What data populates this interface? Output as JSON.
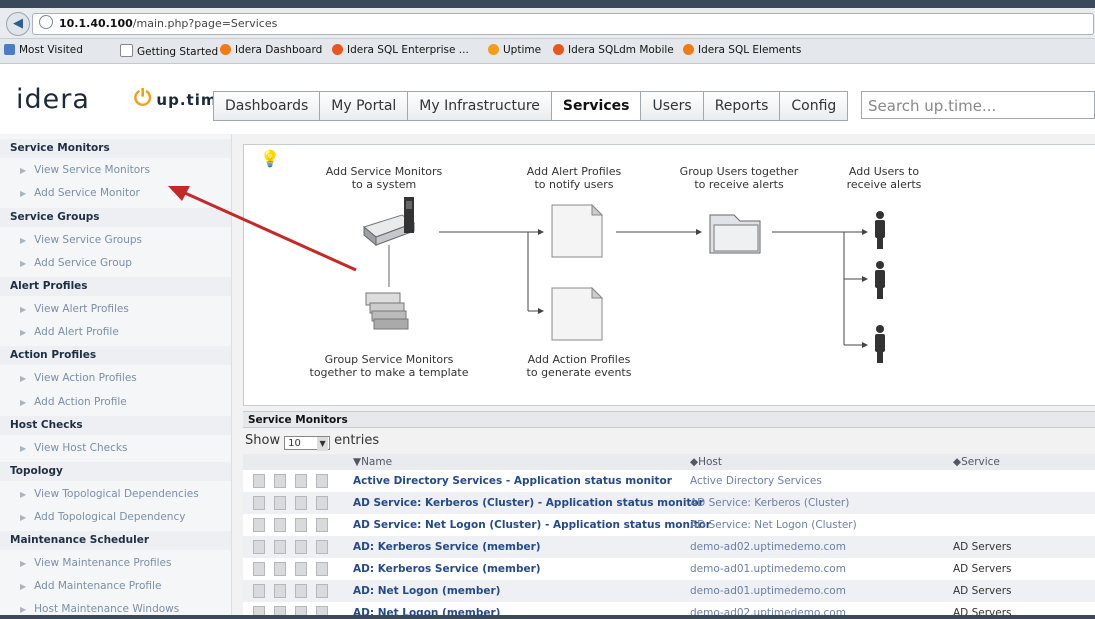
{
  "browser": {
    "url_host": "10.1.40.100",
    "url_path": "/main.php?page=Services",
    "bookmarks": [
      "Most Visited",
      "Getting Started",
      "Idera Dashboard",
      "Idera SQL Enterprise ...",
      "Uptime",
      "Idera SQLdm Mobile",
      "Idera SQL Elements"
    ]
  },
  "app": {
    "logo_text": "idera",
    "product_text": "up.time",
    "nav": [
      "Dashboards",
      "My Portal",
      "My Infrastructure",
      "Services",
      "Users",
      "Reports",
      "Config"
    ],
    "active_nav": "Services",
    "search_placeholder": "Search up.time..."
  },
  "sidebar": {
    "sections": [
      {
        "title": "Service Monitors",
        "links": [
          "View Service Monitors",
          "Add Service Monitor"
        ]
      },
      {
        "title": "Service Groups",
        "links": [
          "View Service Groups",
          "Add Service Group"
        ]
      },
      {
        "title": "Alert Profiles",
        "links": [
          "View Alert Profiles",
          "Add Alert Profile"
        ]
      },
      {
        "title": "Action Profiles",
        "links": [
          "View Action Profiles",
          "Add Action Profile"
        ]
      },
      {
        "title": "Host Checks",
        "links": [
          "View Host Checks"
        ]
      },
      {
        "title": "Topology",
        "links": [
          "View Topological Dependencies",
          "Add Topological Dependency"
        ]
      },
      {
        "title": "Maintenance Scheduler",
        "links": [
          "View Maintenance Profiles",
          "Add Maintenance Profile",
          "Host Maintenance Windows"
        ]
      }
    ]
  },
  "diagram": {
    "step1": [
      "Add Service Monitors",
      "to a system"
    ],
    "step2": [
      "Add Alert Profiles",
      "to notify users"
    ],
    "step3": [
      "Group Users together",
      "to receive alerts"
    ],
    "step4": [
      "Add Users to",
      "receive alerts"
    ],
    "step5": [
      "Group Service Monitors",
      "together to make a template"
    ],
    "step6": [
      "Add Action Profiles",
      "to generate events"
    ]
  },
  "table": {
    "title": "Service Monitors",
    "show_label": "Show",
    "entries_value": "10",
    "entries_label": "entries",
    "columns": [
      "Name",
      "Host",
      "Service Groups"
    ],
    "rows": [
      {
        "name": "Active Directory Services - Application status monitor",
        "host": "Active Directory Services",
        "group": ""
      },
      {
        "name": "AD Service: Kerberos (Cluster) - Application status monitor",
        "host": "AD Service: Kerberos (Cluster)",
        "group": ""
      },
      {
        "name": "AD Service: Net Logon (Cluster) - Application status monitor",
        "host": "AD Service: Net Logon (Cluster)",
        "group": ""
      },
      {
        "name": "AD: Kerberos Service (member)",
        "host": "demo-ad02.uptimedemo.com",
        "group": "AD Servers"
      },
      {
        "name": "AD: Kerberos Service (member)",
        "host": "demo-ad01.uptimedemo.com",
        "group": "AD Servers"
      },
      {
        "name": "AD: Net Logon (member)",
        "host": "demo-ad01.uptimedemo.com",
        "group": "AD Servers"
      },
      {
        "name": "AD: Net Logon (member)",
        "host": "demo-ad02.uptimedemo.com",
        "group": "AD Servers"
      }
    ]
  },
  "colors": {
    "annotation_arrow": "#c62828",
    "link": "#244a8c",
    "power_icon": "#f0a016"
  }
}
